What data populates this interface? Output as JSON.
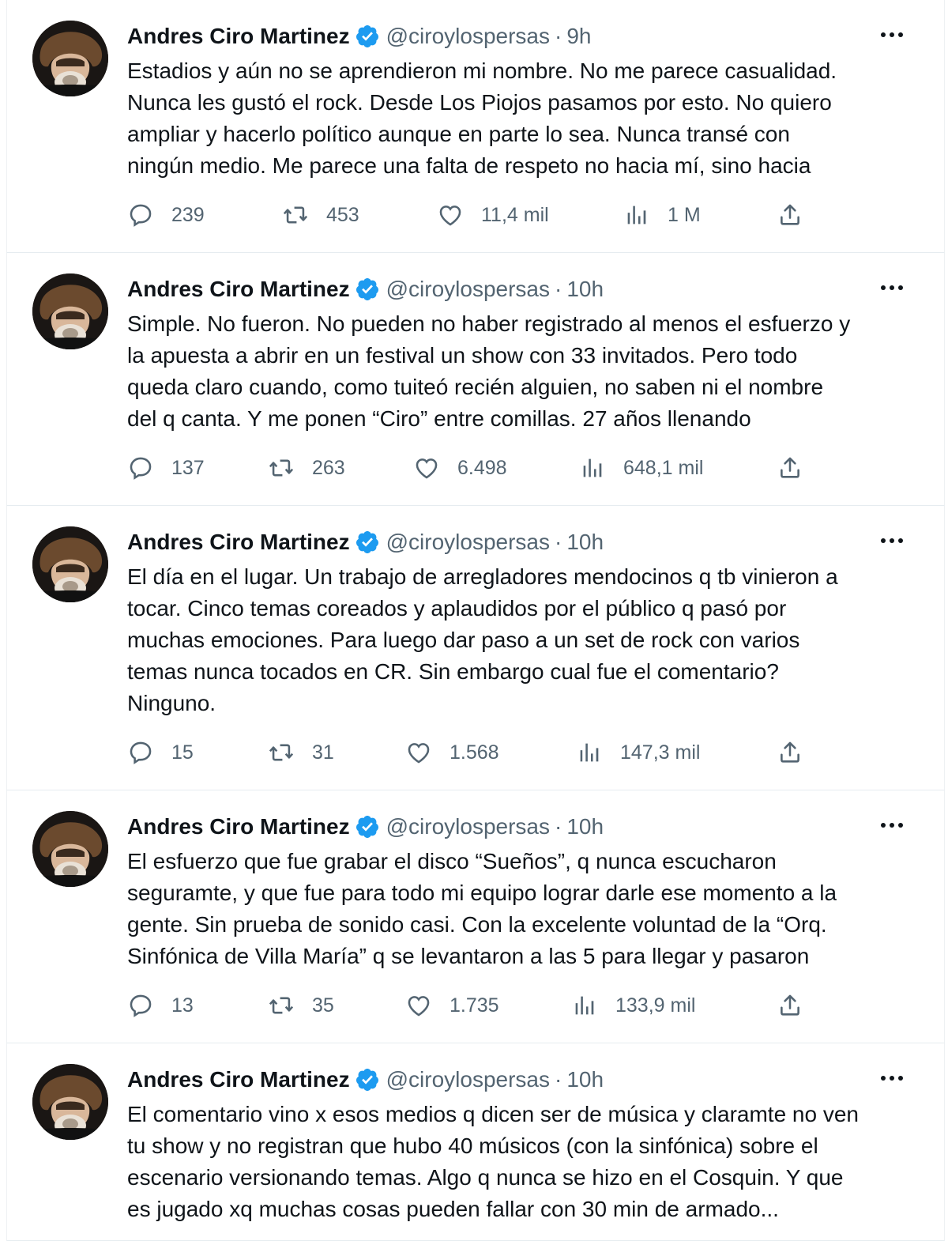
{
  "colors": {
    "verified": "#1d9bf0",
    "secondary_text": "#536471",
    "primary_text": "#0f1419"
  },
  "icons": {
    "reply": "reply-icon",
    "retweet": "retweet-icon",
    "like": "like-icon",
    "views": "views-icon",
    "share": "share-icon",
    "more": "more-icon",
    "verified": "verified-badge-icon"
  },
  "tweets": [
    {
      "author": "Andres Ciro Martinez",
      "handle": "@ciroylospersas",
      "separator": "·",
      "time": "9h",
      "text": "Estadios y aún no se aprendieron mi nombre. No me parece casualidad.\nNunca les gustó el rock. Desde Los Piojos pasamos por esto. No quiero\nampliar y hacerlo político aunque en parte lo sea. Nunca transé con\nningún medio. Me parece una falta de respeto no hacia mí, sino hacia",
      "replies": "239",
      "retweets": "453",
      "likes": "11,4 mil",
      "views": "1 M"
    },
    {
      "author": "Andres Ciro Martinez",
      "handle": "@ciroylospersas",
      "separator": "·",
      "time": "10h",
      "text": "Simple. No fueron. No pueden no haber registrado al menos el esfuerzo y\nla apuesta a abrir en un festival un show con 33 invitados. Pero todo\nqueda claro cuando, como tuiteó recién alguien, no saben ni el nombre\ndel q canta. Y me ponen “Ciro” entre comillas. 27 años llenando",
      "replies": "137",
      "retweets": "263",
      "likes": "6.498",
      "views": "648,1 mil"
    },
    {
      "author": "Andres Ciro Martinez",
      "handle": "@ciroylospersas",
      "separator": "·",
      "time": "10h",
      "text": "El día en el lugar. Un trabajo de arregladores mendocinos q tb vinieron a\ntocar. Cinco temas coreados y aplaudidos por el público q pasó por\nmuchas emociones. Para luego dar paso a un set de rock con varios\ntemas nunca tocados en CR. Sin embargo cual fue el comentario?\nNinguno.",
      "replies": "15",
      "retweets": "31",
      "likes": "1.568",
      "views": "147,3 mil"
    },
    {
      "author": "Andres Ciro Martinez",
      "handle": "@ciroylospersas",
      "separator": "·",
      "time": "10h",
      "text": "El esfuerzo que fue grabar el disco “Sueños”, q nunca escucharon\nseguramte, y que fue para todo mi equipo lograr darle ese momento a la\ngente. Sin prueba de sonido casi. Con la excelente voluntad de la “Orq.\nSinfónica de Villa María” q se levantaron a las 5 para llegar y pasaron",
      "replies": "13",
      "retweets": "35",
      "likes": "1.735",
      "views": "133,9 mil"
    },
    {
      "author": "Andres Ciro Martinez",
      "handle": "@ciroylospersas",
      "separator": "·",
      "time": "10h",
      "text": "El comentario vino x esos medios q dicen ser de música y claramte no ven\ntu show y no registran que hubo 40 músicos (con la sinfónica) sobre el\nescenario versionando temas. Algo q nunca se hizo en el Cosquin. Y que\nes jugado xq muchas cosas pueden fallar con 30 min de armado..."
    }
  ]
}
